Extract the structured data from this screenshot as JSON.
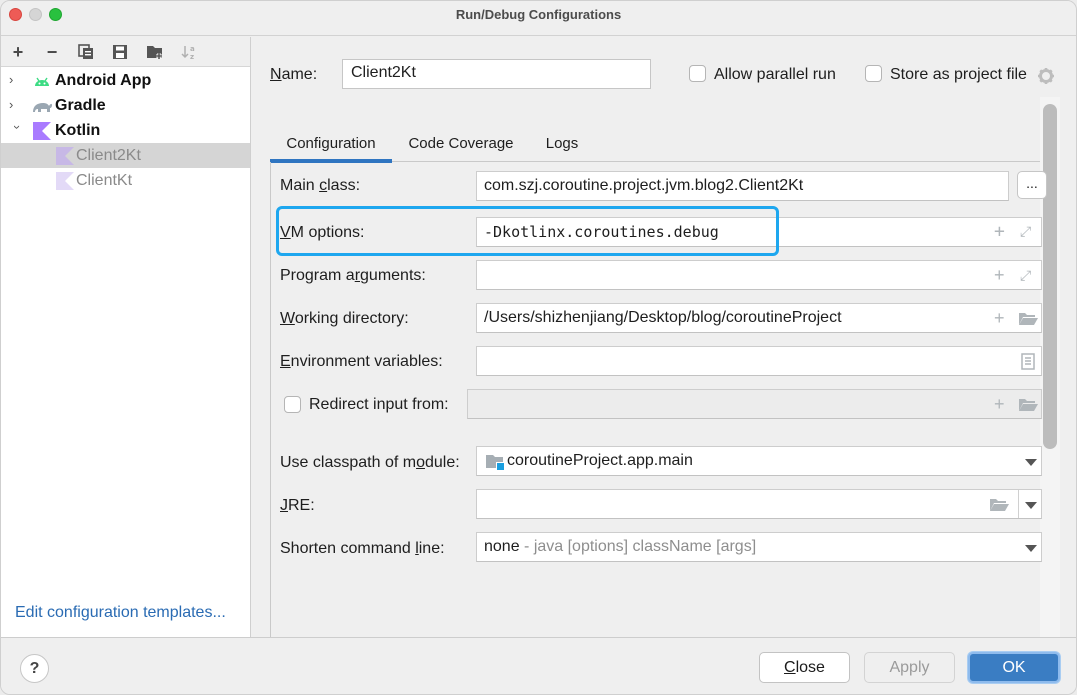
{
  "window": {
    "title": "Run/Debug Configurations"
  },
  "toolbar": {
    "add": "+",
    "remove": "−",
    "copy": "copy-icon",
    "save": "save-icon",
    "new_folder": "new-folder-icon",
    "sort": "sort-icon"
  },
  "tree": {
    "groups": [
      {
        "label": "Android App",
        "expanded": false,
        "icon": "android-icon"
      },
      {
        "label": "Gradle",
        "expanded": false,
        "icon": "gradle-elephant-icon"
      },
      {
        "label": "Kotlin",
        "expanded": true,
        "icon": "kotlin-icon"
      }
    ],
    "children": [
      {
        "label": "Client2Kt",
        "selected": true,
        "icon": "kotlin-icon"
      },
      {
        "label": "ClientKt",
        "selected": false,
        "icon": "kotlin-icon"
      }
    ]
  },
  "edit_templates_link": "Edit configuration templates...",
  "header": {
    "name_label": "Name:",
    "name_value": "Client2Kt",
    "allow_parallel_run": {
      "label": "Allow parallel run",
      "checked": false
    },
    "store_as_project_file": {
      "label": "Store as project file",
      "checked": false
    }
  },
  "tabs": [
    {
      "label": "Configuration",
      "active": true
    },
    {
      "label": "Code Coverage",
      "active": false
    },
    {
      "label": "Logs",
      "active": false
    }
  ],
  "form": {
    "main_class": {
      "label": "Main class:",
      "value": "com.szj.coroutine.project.jvm.blog2.Client2Kt",
      "browse": "..."
    },
    "vm_options": {
      "label": "VM options:",
      "value": "-Dkotlinx.coroutines.debug"
    },
    "program_arguments": {
      "label": "Program arguments:",
      "value": ""
    },
    "working_directory": {
      "label": "Working directory:",
      "value": "/Users/shizhenjiang/Desktop/blog/coroutineProject"
    },
    "environment_variables": {
      "label": "Environment variables:",
      "value": ""
    },
    "redirect_input": {
      "label": "Redirect input from:",
      "checked": false,
      "value": ""
    },
    "classpath_module": {
      "label": "Use classpath of module:",
      "value": "coroutineProject.app.main"
    },
    "jre": {
      "label": "JRE:",
      "value": ""
    },
    "shorten_command_line": {
      "label": "Shorten command line:",
      "value": "none",
      "hint": " - java [options] className [args]"
    }
  },
  "footer": {
    "help": "?",
    "close": "Close",
    "apply": "Apply",
    "ok": "OK"
  },
  "colors": {
    "accent": "#3a7dc3",
    "highlight_border": "#1ea7ef",
    "link": "#2a6bb3",
    "android_green": "#3ddc84",
    "kotlin_purple": "#a97bff"
  }
}
